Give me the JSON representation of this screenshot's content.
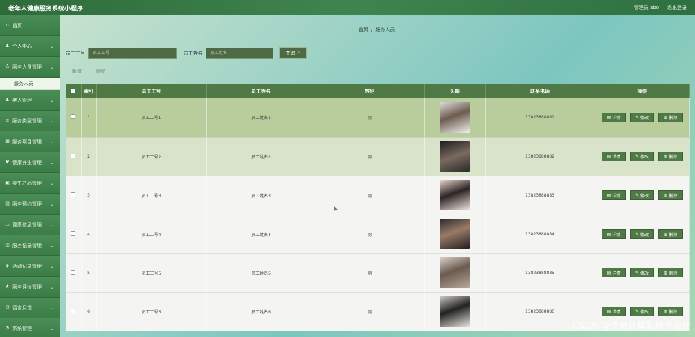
{
  "header": {
    "title": "老年人健康服务系统小程序",
    "user_label": "管理员 abo",
    "logout_label": "退出登录"
  },
  "sidebar": {
    "items": [
      {
        "label": "首页",
        "icon": "home-icon",
        "has_children": false
      },
      {
        "label": "个人中心",
        "icon": "user-icon",
        "has_children": true
      },
      {
        "label": "服务人员管理",
        "icon": "users-icon",
        "has_children": true,
        "expanded": true
      },
      {
        "label": "老人管理",
        "icon": "user-icon",
        "has_children": true
      },
      {
        "label": "服务类型管理",
        "icon": "list-icon",
        "has_children": true
      },
      {
        "label": "服务项目管理",
        "icon": "grid-icon",
        "has_children": true
      },
      {
        "label": "健康养生管理",
        "icon": "heart-icon",
        "has_children": true
      },
      {
        "label": "养生产品管理",
        "icon": "box-icon",
        "has_children": true
      },
      {
        "label": "服务预约管理",
        "icon": "calendar-icon",
        "has_children": true
      },
      {
        "label": "健康信息管理",
        "icon": "file-icon",
        "has_children": true
      },
      {
        "label": "服务记录管理",
        "icon": "record-icon",
        "has_children": true
      },
      {
        "label": "活动记录管理",
        "icon": "activity-icon",
        "has_children": true
      },
      {
        "label": "服务评价管理",
        "icon": "star-icon",
        "has_children": true
      },
      {
        "label": "留言反馈",
        "icon": "message-icon",
        "has_children": true
      },
      {
        "label": "系统管理",
        "icon": "gear-icon",
        "has_children": true
      }
    ],
    "sub_item": "服务人员"
  },
  "breadcrumb": {
    "home": "首页",
    "separator": "/",
    "current": "服务人员"
  },
  "search": {
    "field1_label": "员工工号",
    "field1_placeholder": "员工工号",
    "field2_label": "员工姓名",
    "field2_placeholder": "员工姓名",
    "button_label": "查询"
  },
  "actions": {
    "add_label": "新增",
    "delete_label": "删除"
  },
  "table": {
    "columns": [
      "索引",
      "员工工号",
      "员工姓名",
      "性别",
      "头像",
      "联系电话",
      "操作"
    ],
    "rows": [
      {
        "index": "1",
        "emp_no": "员工工号1",
        "name": "员工姓名1",
        "gender": "男",
        "phone": "13823888881"
      },
      {
        "index": "2",
        "emp_no": "员工工号2",
        "name": "员工姓名2",
        "gender": "男",
        "phone": "13823888882"
      },
      {
        "index": "3",
        "emp_no": "员工工号3",
        "name": "员工姓名3",
        "gender": "男",
        "phone": "13823888883"
      },
      {
        "index": "4",
        "emp_no": "员工工号4",
        "name": "员工姓名4",
        "gender": "男",
        "phone": "13823888884"
      },
      {
        "index": "5",
        "emp_no": "员工工号5",
        "name": "员工姓名5",
        "gender": "男",
        "phone": "13823888885"
      },
      {
        "index": "6",
        "emp_no": "员工工号6",
        "name": "员工姓名6",
        "gender": "男",
        "phone": "13823888886"
      }
    ],
    "op_labels": {
      "detail": "详情",
      "edit": "修改",
      "delete": "删除"
    }
  },
  "watermark": "CSDN @李会计算机程序设计",
  "colors": {
    "header": "#3f8450",
    "sidebar": "#3d7f4a",
    "table_header": "#4f7a45",
    "row_selected": "#b9cc9c"
  }
}
